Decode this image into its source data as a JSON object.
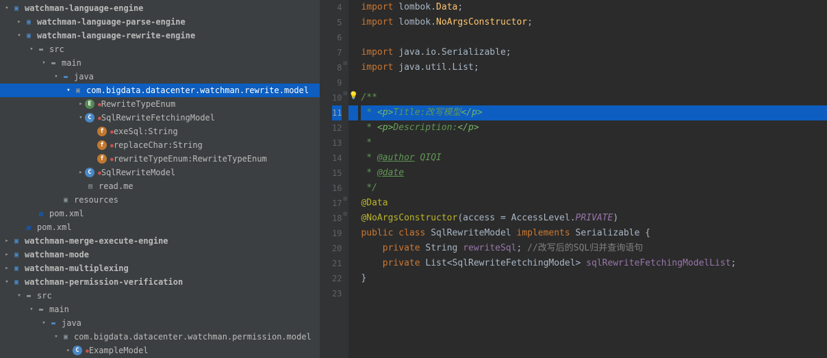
{
  "tree": {
    "root": "watchman-language-engine",
    "parse_engine": "watchman-language-parse-engine",
    "rewrite_engine": "watchman-language-rewrite-engine",
    "src": "src",
    "main": "main",
    "java": "java",
    "package_rewrite": "com.bigdata.datacenter.watchman.rewrite.model",
    "rewrite_enum": "RewriteTypeEnum",
    "fetching_model": "SqlRewriteFetchingModel",
    "field_exeSql": "exeSql:String",
    "field_replaceChar": "replaceChar:String",
    "field_rewriteType": "rewriteTypeEnum:RewriteTypeEnum",
    "sql_rewrite_model": "SqlRewriteModel",
    "readme": "read.me",
    "resources": "resources",
    "pom": "pom.xml",
    "pom2": "pom.xml",
    "merge_engine": "watchman-merge-execute-engine",
    "mode": "watchman-mode",
    "multiplexing": "watchman-multiplexing",
    "permission": "watchman-permission-verification",
    "package_permission": "com.bigdata.datacenter.watchman.permission.model",
    "example_model": "ExampleModel"
  },
  "gutter": [
    "4",
    "5",
    "6",
    "7",
    "8",
    "9",
    "10",
    "11",
    "12",
    "13",
    "14",
    "15",
    "16",
    "17",
    "18",
    "19",
    "20",
    "21",
    "22",
    "23"
  ],
  "code": {
    "l4": {
      "kw": "import",
      "pkg": " lombok.",
      "cls": "Data",
      "semi": ";"
    },
    "l5": {
      "kw": "import",
      "pkg": " lombok.",
      "cls": "NoArgsConstructor",
      "semi": ";"
    },
    "l7": {
      "kw": "import",
      "pkg": " java.io.Serializable;"
    },
    "l8": {
      "kw": "import",
      "pkg": " java.util.List;"
    },
    "l10": {
      "open": "/**"
    },
    "l11": {
      "star": " * ",
      "open": "<p>",
      "t": "Title:改写模型",
      "close": "</p>"
    },
    "l12": {
      "star": " * ",
      "open": "<p>",
      "t": "Description:",
      "close": "</p>"
    },
    "l13": {
      "star": " *"
    },
    "l14": {
      "star": " * ",
      "tag": "@author",
      "val": " QIQI"
    },
    "l15": {
      "star": " * ",
      "tag": "@date"
    },
    "l16": {
      "star": " */"
    },
    "l17": {
      "anno": "@Data"
    },
    "l18": {
      "anno": "@NoArgsConstructor",
      "paren": "(",
      "param": "access = AccessLevel.",
      "val": "PRIVATE",
      "close": ")"
    },
    "l19": {
      "mods": "public class ",
      "name": "SqlRewriteModel ",
      "impl": "implements ",
      "iface": "Serializable {"
    },
    "l20": {
      "indent": "    ",
      "mod": "private ",
      "type": "String ",
      "name": "rewriteSql",
      "semi": "; ",
      "comment": "//改写后的SQL归并查询语句"
    },
    "l21": {
      "indent": "    ",
      "mod": "private ",
      "type": "List",
      "lt": "<",
      "gen": "SqlRewriteFetchingModel",
      "gt": "> ",
      "name": "sqlRewriteFetchingModelList",
      "semi": ";"
    },
    "l22": {
      "brace": "}"
    }
  }
}
